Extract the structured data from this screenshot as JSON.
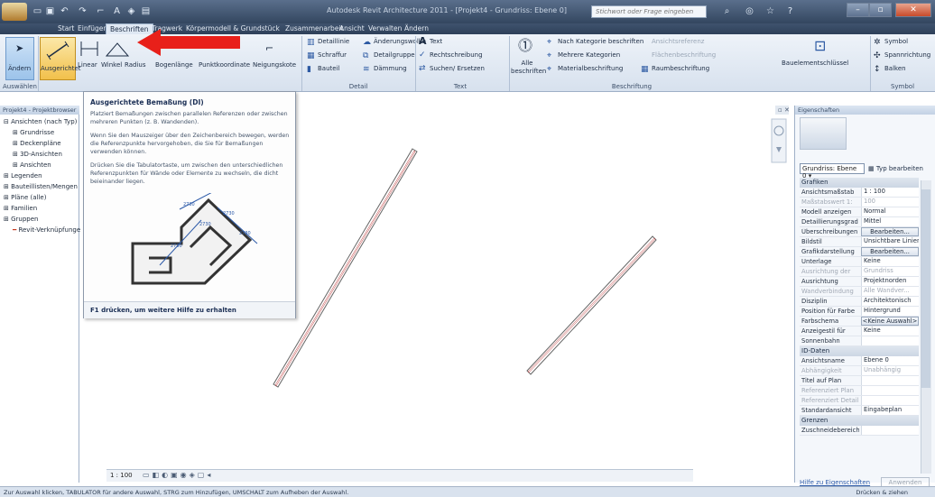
{
  "window": {
    "title": "Autodesk Revit Architecture 2011 - [Projekt4 - Grundriss: Ebene 0]",
    "search_placeholder": "Stichwort oder Frage eingeben",
    "quick_access": [
      "open-icon",
      "save-icon",
      "undo-icon",
      "redo-icon",
      "measure-icon",
      "text-icon",
      "sync-icon",
      "thin-lines-icon"
    ]
  },
  "tabs": [
    "Start",
    "Einfügen",
    "Beschriften",
    "Tragwerk",
    "Körpermodell & Grundstück",
    "Zusammenarbeit",
    "Ansicht",
    "Verwalten",
    "Ändern"
  ],
  "ribbon": {
    "select_panel": {
      "button": "Ändern",
      "label": "Auswählen"
    },
    "dimension_panel": {
      "buttons": [
        "Ausgerichtet",
        "Linear",
        "Winkel",
        "Radius",
        "Bogenlänge",
        "Punktkoordinate",
        "Neigungskote"
      ]
    },
    "detail_panel": {
      "label": "Detail",
      "items": [
        "Detaillinie",
        "Schraffur",
        "Bauteil",
        "Änderungswolke",
        "Detailgruppe",
        "Dämmung"
      ]
    },
    "text_panel": {
      "label": "Text",
      "items": [
        "Text",
        "Rechtschreibung",
        "Suchen/ Ersetzen"
      ]
    },
    "tag_panel": {
      "label": "Beschriftung",
      "items": [
        "Alle beschriften",
        "Nach Kategorie beschriften",
        "Mehrere Kategorien",
        "Materialbeschriftung",
        "Ansichtsreferenz",
        "Flächenbeschriftung",
        "Raumbeschriftung",
        "Bauelementschlüssel"
      ]
    },
    "symbol_panel": {
      "label": "Symbol",
      "items": [
        "Symbol",
        "Spannrichtung",
        "Balken"
      ]
    }
  },
  "tooltip": {
    "title": "Ausgerichtete Bemaßung (DI)",
    "p1": "Platziert Bemaßungen zwischen parallelen Referenzen oder zwischen mehreren Punkten (z. B. Wandenden).",
    "p2": "Wenn Sie den Mauszeiger über den Zeichenbereich bewegen, werden die Referenzpunkte hervorgehoben, die Sie für Bemaßungen verwenden können.",
    "p3": "Drücken Sie die Tabulatortaste, um zwischen den unterschiedlichen Referenzpunkten für Wände oder Elemente zu wechseln, die dicht beieinander liegen.",
    "footer": "F1 drücken, um weitere Hilfe zu erhalten",
    "dims": [
      "2730",
      "2730",
      "2730",
      "2730",
      "2730"
    ]
  },
  "browser": {
    "header": "Projekt4 - Projektbrowser",
    "items": [
      "Ansichten (nach Typ)",
      "Grundrisse",
      "Deckenpläne",
      "3D-Ansichten",
      "Ansichten",
      "Legenden",
      "Bauteillisten/Mengen",
      "Pläne (alle)",
      "Familien",
      "Gruppen",
      "Revit-Verknüpfungen"
    ]
  },
  "viewbar": {
    "scale": "1 : 100"
  },
  "properties": {
    "header": "Eigenschaften",
    "type_select": "Grundriss: Ebene 0",
    "edit_type": "Typ bearbeiten",
    "groups": {
      "graphics": "Grafiken",
      "identity": "ID-Daten",
      "extents": "Grenzen"
    },
    "graphics_rows": [
      {
        "label": "Ansichtsmaßstab",
        "value": "1 : 100"
      },
      {
        "label": "Maßstabswert 1:",
        "value": "100",
        "disabled": true
      },
      {
        "label": "Modell anzeigen",
        "value": "Normal"
      },
      {
        "label": "Detaillierungsgrad",
        "value": "Mittel"
      },
      {
        "label": "Überschreibungen",
        "value": "Bearbeiten...",
        "button": true
      },
      {
        "label": "Bildstil",
        "value": "Unsichtbare Linien"
      },
      {
        "label": "Grafikdarstellung",
        "value": "Bearbeiten...",
        "button": true
      },
      {
        "label": "Unterlage",
        "value": "Keine"
      },
      {
        "label": "Ausrichtung der",
        "value": "Grundriss",
        "disabled": true
      },
      {
        "label": "Ausrichtung",
        "value": "Projektnorden"
      },
      {
        "label": "Wandverbindung",
        "value": "Alle Wandver...",
        "disabled": true
      },
      {
        "label": "Disziplin",
        "value": "Architektonisch"
      },
      {
        "label": "Position für Farbe",
        "value": "Hintergrund"
      },
      {
        "label": "Farbschema",
        "value": "<Keine Auswahl>",
        "button": true
      },
      {
        "label": "Anzeigestil für",
        "value": "Keine"
      },
      {
        "label": "Sonnenbahn",
        "value": ""
      }
    ],
    "identity_rows": [
      {
        "label": "Ansichtsname",
        "value": "Ebene 0"
      },
      {
        "label": "Abhängigkeit",
        "value": "Unabhängig",
        "disabled": true
      },
      {
        "label": "Titel auf Plan",
        "value": ""
      },
      {
        "label": "Referenziert Plan",
        "value": "",
        "disabled": true
      },
      {
        "label": "Referenziert Detail",
        "value": "",
        "disabled": true
      },
      {
        "label": "Standardansicht",
        "value": "Eingabeplan"
      }
    ],
    "extents_rows": [
      {
        "label": "Zuschneidebereich",
        "value": ""
      }
    ],
    "help_link": "Hilfe zu Eigenschaften",
    "apply": "Anwenden"
  },
  "status": {
    "text": "Zur Auswahl klicken, TABULATOR für andere Auswahl, STRG zum Hinzufügen, UMSCHALT zum Aufheben der Auswahl.",
    "right": "Drücken & ziehen"
  },
  "colors": {
    "arrow": "#e8201a",
    "accent": "#2d5aa3"
  }
}
